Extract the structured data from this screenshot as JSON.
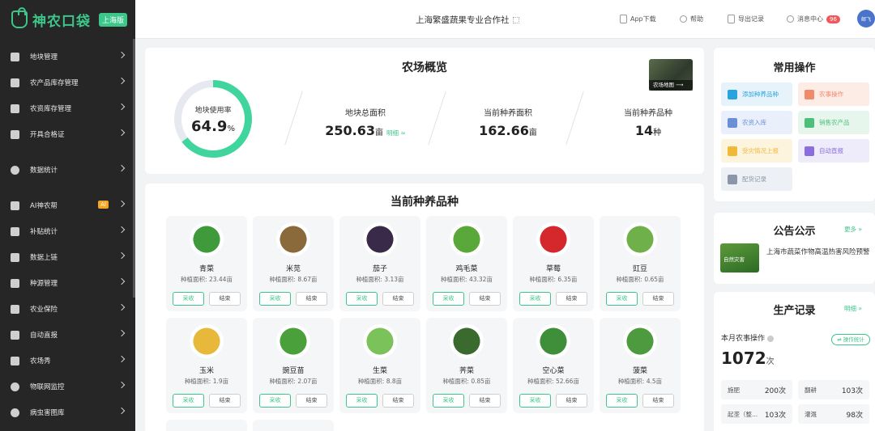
{
  "brand": {
    "name": "神农口袋",
    "badge": "上海版"
  },
  "sidebar": {
    "items": [
      {
        "label": "地块管理",
        "icon": "land-icon"
      },
      {
        "label": "农产品库存管理",
        "icon": "inventory-icon"
      },
      {
        "label": "农资库存管理",
        "icon": "warehouse-icon"
      },
      {
        "label": "开具合格证",
        "icon": "printer-icon"
      },
      {
        "label": "数据统计",
        "icon": "pie-chart-icon"
      },
      {
        "label": "AI神农帮",
        "icon": "ai-chat-icon",
        "badge": "AI"
      },
      {
        "label": "补贴统计",
        "icon": "subsidy-icon"
      },
      {
        "label": "数据上链",
        "icon": "shield-icon"
      },
      {
        "label": "种源管理",
        "icon": "seed-icon"
      },
      {
        "label": "农业保险",
        "icon": "insurance-icon"
      },
      {
        "label": "自动直报",
        "icon": "report-icon"
      },
      {
        "label": "农场秀",
        "icon": "image-icon"
      },
      {
        "label": "物联网监控",
        "icon": "camera-icon"
      },
      {
        "label": "病虫害图库",
        "icon": "bug-icon"
      }
    ]
  },
  "topbar": {
    "org_name": "上海繁盛蔬果专业合作社",
    "app_download": "App下载",
    "help": "帮助",
    "export_records": "导出记录",
    "message_center": "消息中心",
    "message_count": "96",
    "avatar_text": "邮飞"
  },
  "overview": {
    "title": "农场概览",
    "usage_label": "地块使用率",
    "usage_value": "64.9",
    "usage_unit": "%",
    "usage_fraction": 0.649,
    "total_area_label": "地块总面积",
    "total_area_value": "250.63",
    "total_area_unit": "亩",
    "detail_link": "明细 ≈",
    "planting_area_label": "当前种养面积",
    "planting_area_value": "162.66",
    "planting_area_unit": "亩",
    "varieties_label": "当前种养品种",
    "varieties_value": "14",
    "varieties_unit": "种",
    "map_label": "农场地图 ⟶"
  },
  "current": {
    "title": "当前种养品种",
    "area_prefix": "种植面积:",
    "harvest_label": "采收",
    "finish_label": "结束",
    "crops": [
      {
        "name": "青菜",
        "area": "23.44亩",
        "color": "#3e9a3a"
      },
      {
        "name": "米苋",
        "area": "8.67亩",
        "color": "#8a6a3a"
      },
      {
        "name": "茄子",
        "area": "3.13亩",
        "color": "#3a2a4a"
      },
      {
        "name": "鸡毛菜",
        "area": "43.32亩",
        "color": "#5aa83a"
      },
      {
        "name": "草莓",
        "area": "6.35亩",
        "color": "#d4282c"
      },
      {
        "name": "豇豆",
        "area": "0.65亩",
        "color": "#6fb04a"
      },
      {
        "name": "玉米",
        "area": "1.9亩",
        "color": "#e8b83a"
      },
      {
        "name": "豌豆苗",
        "area": "2.07亩",
        "color": "#4aa03a"
      },
      {
        "name": "生菜",
        "area": "8.8亩",
        "color": "#7cc25a"
      },
      {
        "name": "荠菜",
        "area": "0.85亩",
        "color": "#3a6a2e"
      },
      {
        "name": "空心菜",
        "area": "52.66亩",
        "color": "#3f8f3a"
      },
      {
        "name": "菠菜",
        "area": "4.5亩",
        "color": "#4e9a3e"
      }
    ]
  },
  "quick_ops": {
    "title": "常用操作",
    "items": [
      {
        "label": "添加种养品种",
        "bg": "#e6f3fb",
        "icon_color": "#29a3e0"
      },
      {
        "label": "农事操作",
        "bg": "#fdebe6",
        "icon_color": "#f08a6a"
      },
      {
        "label": "农资入库",
        "bg": "#e9effb",
        "icon_color": "#6b8fd6"
      },
      {
        "label": "销售农产品",
        "bg": "#e7f6ec",
        "icon_color": "#4cc07a"
      },
      {
        "label": "受灾情况上报",
        "bg": "#fdf4de",
        "icon_color": "#f0b93a"
      },
      {
        "label": "自动直报",
        "bg": "#eeebfb",
        "icon_color": "#8a6ee0"
      },
      {
        "label": "配货记录",
        "bg": "#edf0f4",
        "icon_color": "#8b96a8"
      }
    ]
  },
  "notice": {
    "title": "公告公示",
    "more": "更多 »",
    "image_text": "自然灾害",
    "text": "上海市蔬菜作物高温热害风险预警"
  },
  "production": {
    "title": "生产记录",
    "detail_link": "明细 »",
    "month_label": "本月农事操作",
    "month_value": "1072",
    "month_unit": "次",
    "stats_button": "⇌ 操作统计",
    "records": [
      {
        "label": "施肥",
        "value": "200次"
      },
      {
        "label": "翻耕",
        "value": "103次"
      },
      {
        "label": "起垄（整...",
        "value": "103次"
      },
      {
        "label": "灌溉",
        "value": "98次"
      }
    ]
  }
}
